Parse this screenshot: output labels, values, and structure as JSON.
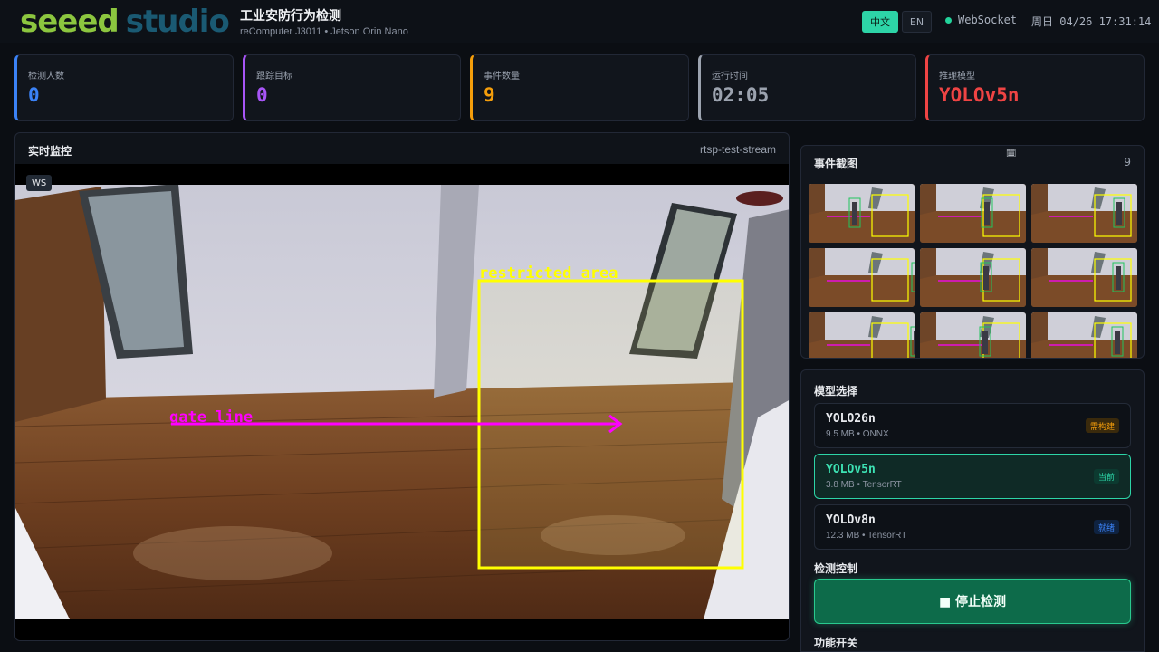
{
  "header": {
    "logo_primary": "seeed",
    "logo_secondary": "studio",
    "title": "工业安防行为检测",
    "subtitle": "reComputer J3011 • Jetson Orin Nano",
    "lang_zh": "中文",
    "lang_en": "EN",
    "connection": "WebSocket",
    "datetime": "周日 04/26 17:31:14",
    "colors": {
      "accent": "#2dd4a7",
      "brand_green": "#8cc63f",
      "brand_blue": "#1a5a73"
    }
  },
  "stats": [
    {
      "label": "检测人数",
      "value": "0",
      "color": "#3b82f6"
    },
    {
      "label": "跟踪目标",
      "value": "0",
      "color": "#a855f7"
    },
    {
      "label": "事件数量",
      "value": "9",
      "color": "#f59e0b"
    },
    {
      "label": "运行时间",
      "value": "02:05",
      "color": "#9ca3af"
    },
    {
      "label": "推理模型",
      "value": "YOLOv5n",
      "color": "#ef4444"
    }
  ],
  "video": {
    "title": "实时监控",
    "stream": "rtsp-test-stream",
    "badge": "WS",
    "zone_label": "restricted area",
    "line_label": "gate line"
  },
  "events": {
    "title": "事件截图",
    "count": "9",
    "icon": "calendar-icon"
  },
  "models": {
    "title": "模型选择",
    "items": [
      {
        "name": "YOLO26n",
        "size": "9.5 MB",
        "format": "ONNX",
        "status": "需构建",
        "status_color": "#f59e0b"
      },
      {
        "name": "YOLOv5n",
        "size": "3.8 MB",
        "format": "TensorRT",
        "status": "当前",
        "status_color": "#2dd4a7"
      },
      {
        "name": "YOLOv8n",
        "size": "12.3 MB",
        "format": "TensorRT",
        "status": "就绪",
        "status_color": "#3b82f6"
      }
    ]
  },
  "control": {
    "title": "检测控制",
    "stop_label": "■ 停止检测",
    "next_section": "功能开关"
  }
}
